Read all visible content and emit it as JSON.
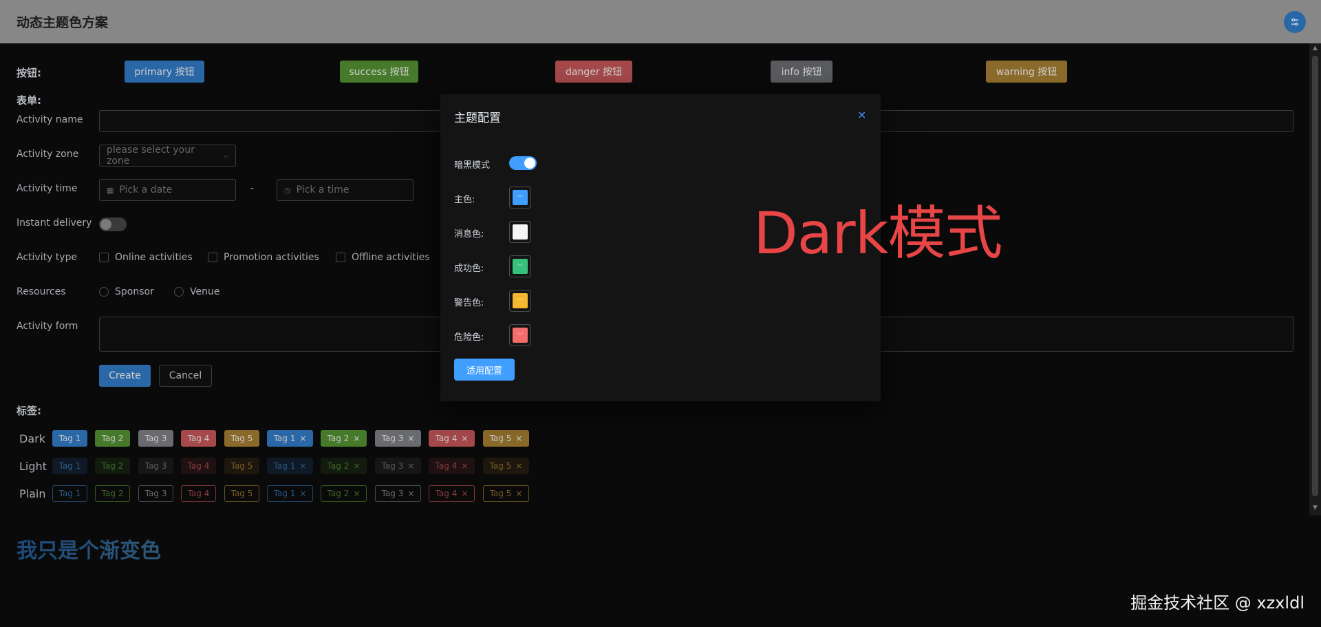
{
  "header": {
    "title": "动态主题色方案",
    "settings_icon": "sliders-icon"
  },
  "buttons": {
    "label": "按钮:",
    "items": [
      {
        "label": "primary 按钮",
        "color": "#2a67a6"
      },
      {
        "label": "success 按钮",
        "color": "#467a2a"
      },
      {
        "label": "danger 按钮",
        "color": "#a5494b"
      },
      {
        "label": "info 按钮",
        "color": "#5a5b5e"
      },
      {
        "label": "warning 按钮",
        "color": "#8a6a2a"
      }
    ]
  },
  "form": {
    "label": "表单:",
    "activity_name": {
      "label": "Activity name",
      "value": ""
    },
    "activity_zone": {
      "label": "Activity zone",
      "placeholder": "please select your zone"
    },
    "activity_time": {
      "label": "Activity time",
      "date_placeholder": "Pick a date",
      "separator": "-",
      "time_placeholder": "Pick a time"
    },
    "instant_delivery": {
      "label": "Instant delivery",
      "on": false
    },
    "activity_type": {
      "label": "Activity type",
      "options": [
        "Online activities",
        "Promotion activities",
        "Offline activities"
      ]
    },
    "resources": {
      "label": "Resources",
      "options": [
        "Sponsor",
        "Venue"
      ]
    },
    "activity_form": {
      "label": "Activity form",
      "value": ""
    },
    "create_label": "Create",
    "cancel_label": "Cancel"
  },
  "tags": {
    "label": "标签:",
    "rows": [
      {
        "name": "Dark",
        "tags": [
          "Tag 1",
          "Tag 2",
          "Tag 3",
          "Tag 4",
          "Tag 5"
        ]
      },
      {
        "name": "Light",
        "tags": [
          "Tag 1",
          "Tag 2",
          "Tag 3",
          "Tag 4",
          "Tag 5"
        ]
      },
      {
        "name": "Plain",
        "tags": [
          "Tag 1",
          "Tag 2",
          "Tag 3",
          "Tag 4",
          "Tag 5"
        ]
      }
    ],
    "close_glyph": "×"
  },
  "gradient_text": "我只是个渐变色",
  "dialog": {
    "title": "主题配置",
    "close_glyph": "×",
    "dark_mode_label": "暗黑模式",
    "dark_mode_on": true,
    "colors": [
      {
        "label": "主色:",
        "value": "#409eff"
      },
      {
        "label": "消息色:",
        "value": "#f4f4f5"
      },
      {
        "label": "成功色:",
        "value": "#36c27a"
      },
      {
        "label": "警告色:",
        "value": "#f5b82e"
      },
      {
        "label": "危险色:",
        "value": "#f56c6c"
      }
    ],
    "apply_label": "适用配置"
  },
  "annotation": "Dark模式",
  "watermark": "掘金技术社区 @ xzxldl"
}
